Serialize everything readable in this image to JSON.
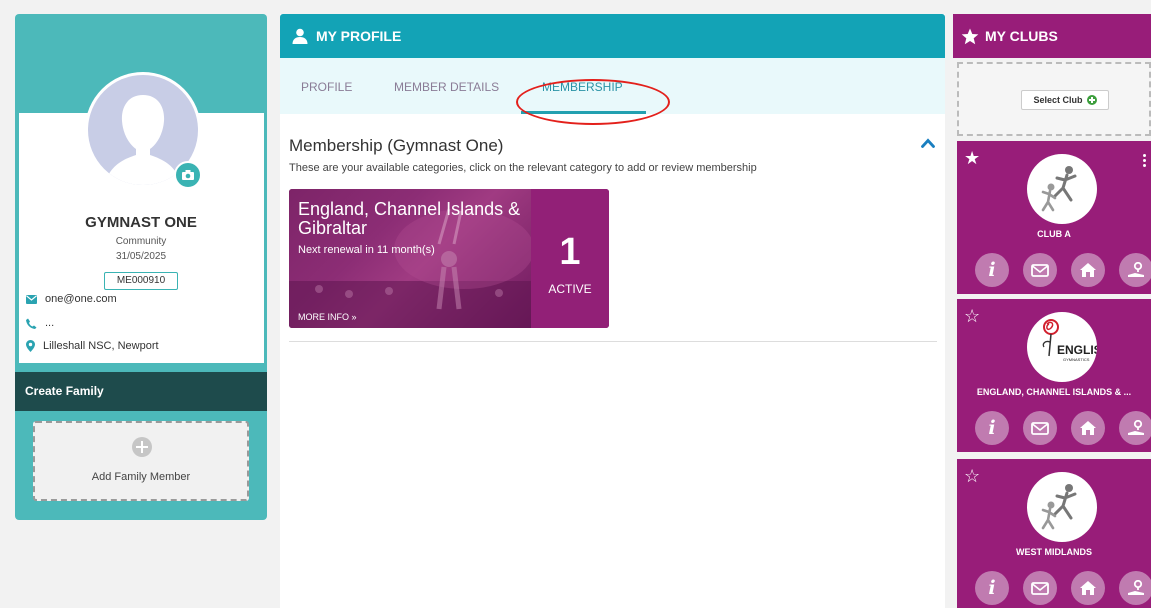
{
  "profile": {
    "name": "GYMNAST ONE",
    "type": "Community",
    "date": "31/05/2025",
    "member_id": "ME000910",
    "email": "one@one.com",
    "phone": "...",
    "location": "Lilleshall NSC, Newport"
  },
  "family": {
    "create_label": "Create Family",
    "add_label": "Add Family Member"
  },
  "center": {
    "header_title": "MY PROFILE",
    "tabs": [
      {
        "label": "PROFILE"
      },
      {
        "label": "MEMBER DETAILS"
      },
      {
        "label": "MEMBERSHIP",
        "active": true
      }
    ],
    "membership_title": "Membership (Gymnast One)",
    "membership_subtitle": "These are your available categories, click on the relevant category to add or review membership",
    "card": {
      "name": "England, Channel Islands & Gibraltar",
      "renewal": "Next renewal in 11 month(s)",
      "count": "1",
      "status": "ACTIVE",
      "more_info": "MORE INFO"
    }
  },
  "right": {
    "header_title": "MY CLUBS",
    "select_club": "Select Club",
    "clubs": [
      {
        "name": "CLUB A",
        "favourite": true
      },
      {
        "name": "ENGLAND, CHANNEL ISLANDS & ...",
        "favourite": false
      },
      {
        "name": "WEST MIDLANDS",
        "favourite": false
      }
    ]
  },
  "colors": {
    "teal": "#4cb9ba",
    "header_teal": "#13a3b6",
    "dark_teal": "#1e4b4c",
    "club_purple": "#981d79",
    "card_purple": "#922077",
    "annotation_red": "#e3201b"
  },
  "icons": [
    "user-icon",
    "camera-icon",
    "email-icon",
    "phone-icon",
    "location-pin-icon",
    "plus-icon",
    "chevron-up-icon",
    "star-icon",
    "info-icon",
    "envelope-icon",
    "home-icon",
    "map-person-icon"
  ]
}
